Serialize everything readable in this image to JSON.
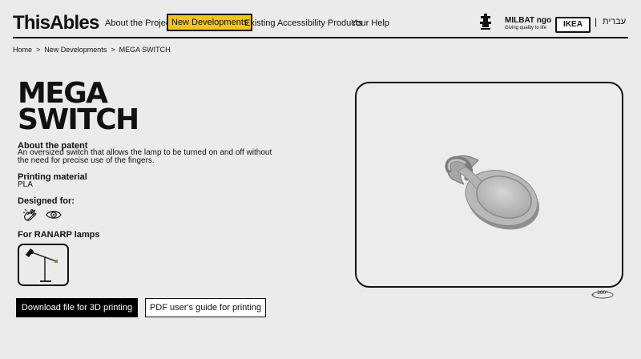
{
  "header": {
    "logo": "ThisAbles",
    "nav": [
      {
        "label": "About the Project"
      },
      {
        "label": "New Developments"
      },
      {
        "label": "Existing Accessibility Products"
      },
      {
        "label": "Your Help"
      }
    ],
    "partners": {
      "milbat_name": "MILBAT ngo",
      "milbat_tagline": "Giving quality to life",
      "ikea": "IKEA"
    },
    "separator": "|",
    "language": "עברית"
  },
  "breadcrumb": [
    "Home",
    "New Developments",
    "MEGA SWITCH"
  ],
  "breadcrumb_sep": ">",
  "product": {
    "title": "MEGA SWITCH",
    "about_heading": "About the patent",
    "about_text": "An oversized switch that allows the lamp to be turned on and off without the need for precise use of the fingers.",
    "material_heading": "Printing material",
    "material_value": "PLA",
    "designed_for_heading": "Designed for:",
    "designed_for_icons": [
      "hand-icon",
      "eye-icon"
    ],
    "for_heading": "For RANARP lamps",
    "lamp_image": "ranarp-lamp-icon"
  },
  "buttons": {
    "download": "Download file for 3D printing",
    "pdf": "PDF user's guide for printing"
  },
  "viewer": {
    "rotate_label": "360°"
  }
}
